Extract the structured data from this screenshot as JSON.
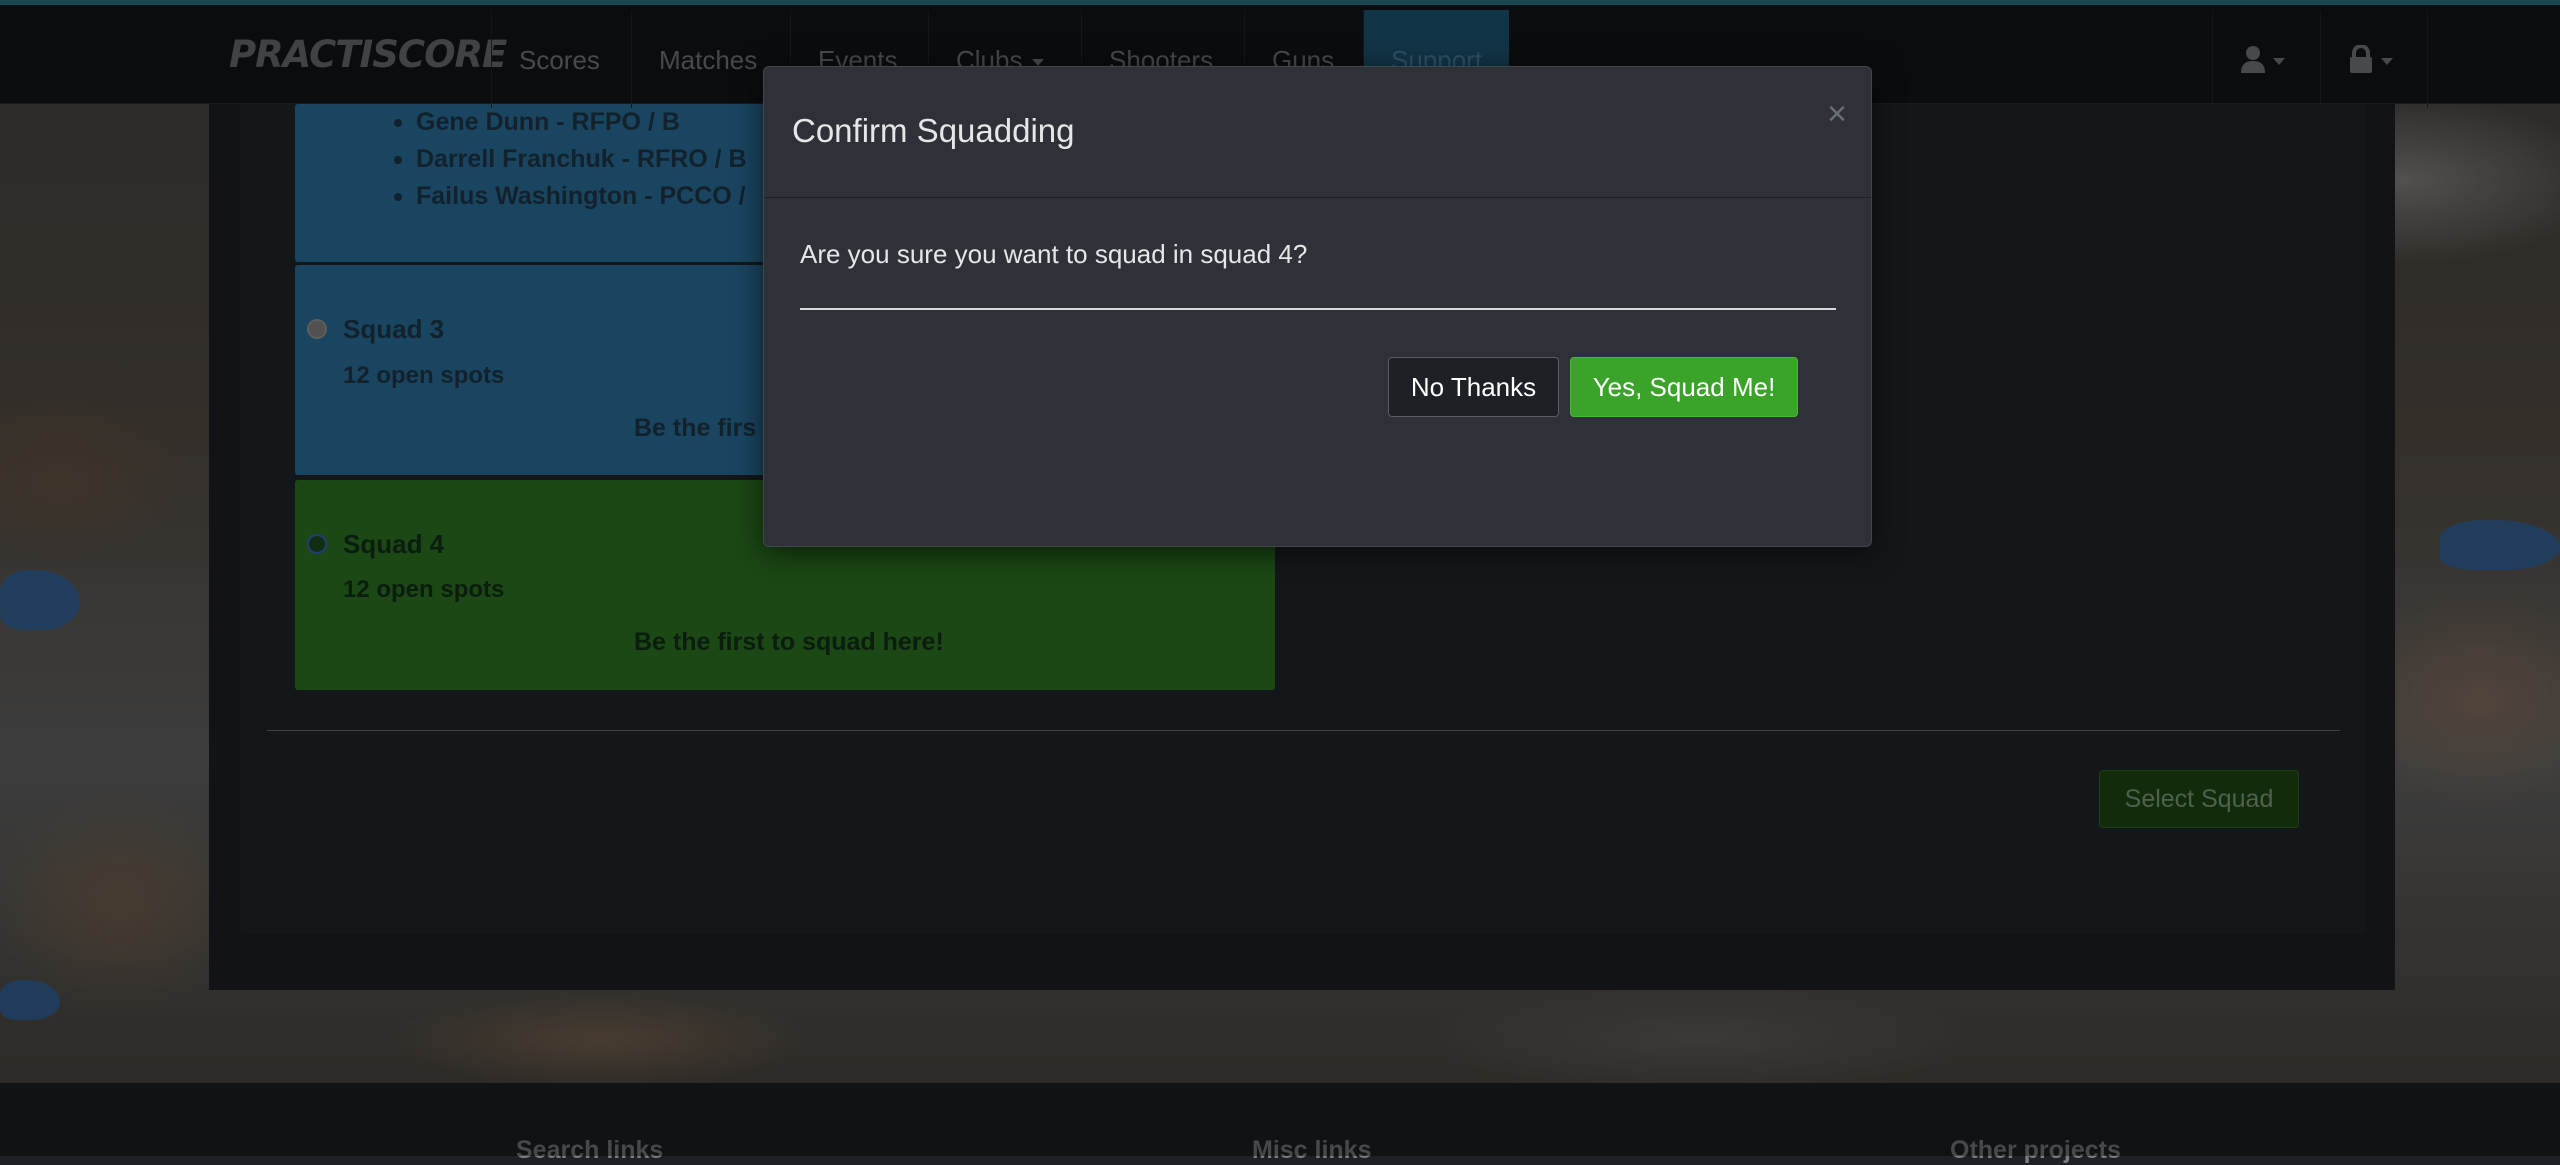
{
  "navbar": {
    "brand": "PRACTISCORE",
    "items": [
      {
        "label": "Scores"
      },
      {
        "label": "Matches"
      },
      {
        "label": "Events"
      },
      {
        "label": "Clubs"
      },
      {
        "label": "Shooters"
      },
      {
        "label": "Guns"
      },
      {
        "label": "Support"
      }
    ],
    "user_menu_icon": "user-icon",
    "lock_menu_icon": "lock-icon"
  },
  "squad_list": {
    "members": [
      "Gene Dunn - RFPO / B",
      "Darrell Franchuk - RFRO / B",
      "Failus Washington - PCCO /"
    ],
    "squads": [
      {
        "title": "Squad 3",
        "spots": "12 open spots",
        "cta": "Be the first to squad here!",
        "cta_visible": "Be the firs"
      },
      {
        "title": "Squad 4",
        "spots": "12 open spots",
        "cta": "Be the first to squad here!"
      }
    ],
    "select_button": "Select Squad"
  },
  "footer": {
    "headings": [
      "Search links",
      "Misc links",
      "Other projects"
    ]
  },
  "modal": {
    "title": "Confirm Squadding",
    "close_glyph": "×",
    "question": "Are you sure you want to squad in squad 4?",
    "no_button": "No Thanks",
    "yes_button": "Yes, Squad Me!"
  },
  "colors": {
    "accent_blue": "#2d77a5",
    "accent_green": "#2f7c24",
    "confirm_green": "#3ca32a",
    "topbar_teal": "#2a7a8e"
  }
}
